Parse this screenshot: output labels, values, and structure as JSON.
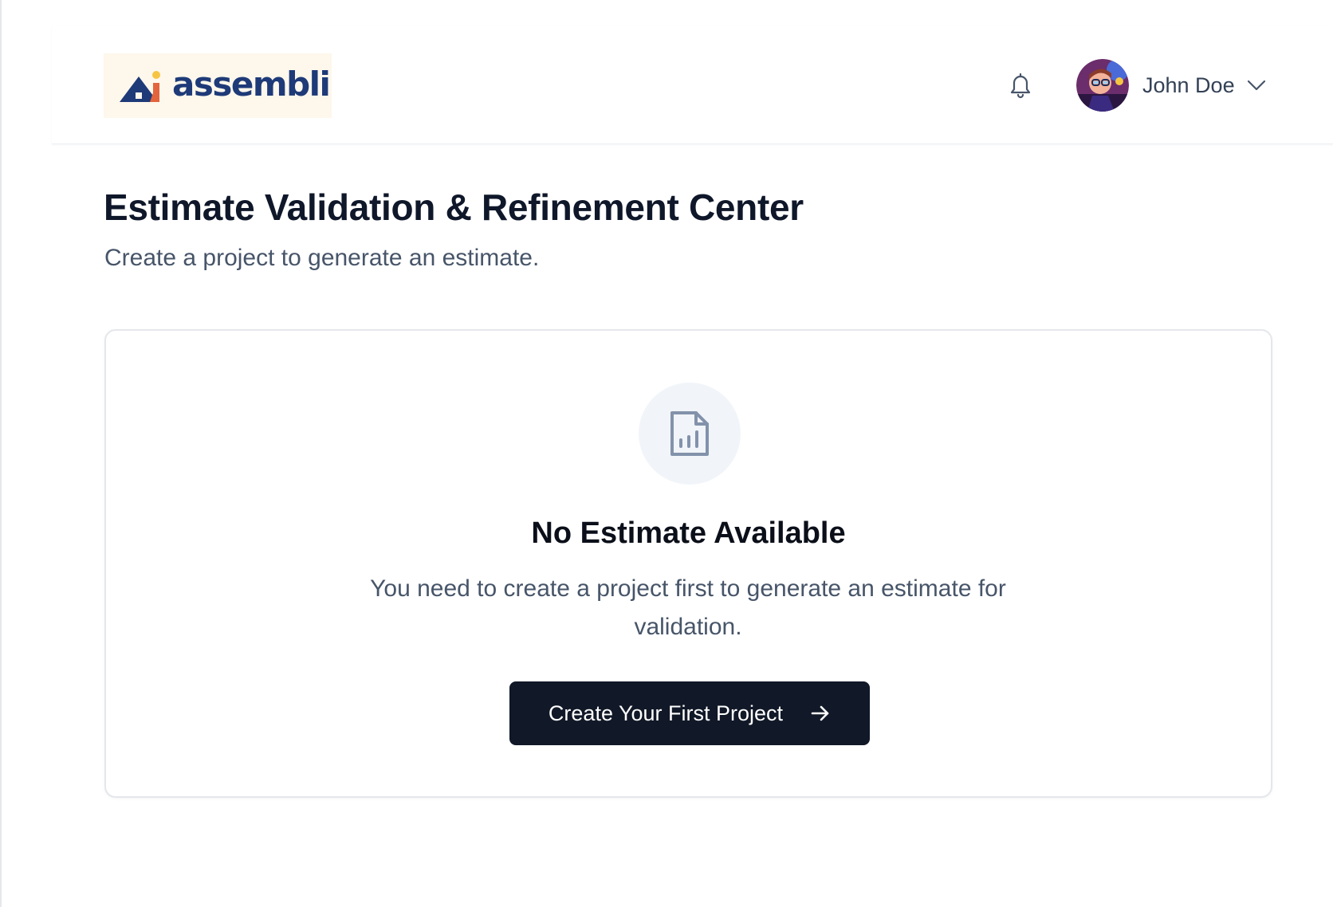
{
  "header": {
    "logo_text": "assembli",
    "notifications_icon": "bell-icon",
    "user": {
      "name": "John Doe",
      "avatar_icon": "avatar",
      "menu_icon": "chevron-down-icon"
    }
  },
  "page": {
    "title": "Estimate Validation & Refinement Center",
    "subtitle": "Create a project to generate an estimate."
  },
  "empty_state": {
    "icon": "file-chart-icon",
    "title": "No Estimate Available",
    "description": "You need to create a project first to generate an estimate for validation.",
    "cta_label": "Create Your First Project",
    "cta_icon": "arrow-right-icon"
  },
  "colors": {
    "brand_navy": "#1e3a78",
    "brand_orange": "#e3643c",
    "brand_yellow": "#f5c542",
    "button_bg": "#111827",
    "muted_text": "#475569"
  }
}
